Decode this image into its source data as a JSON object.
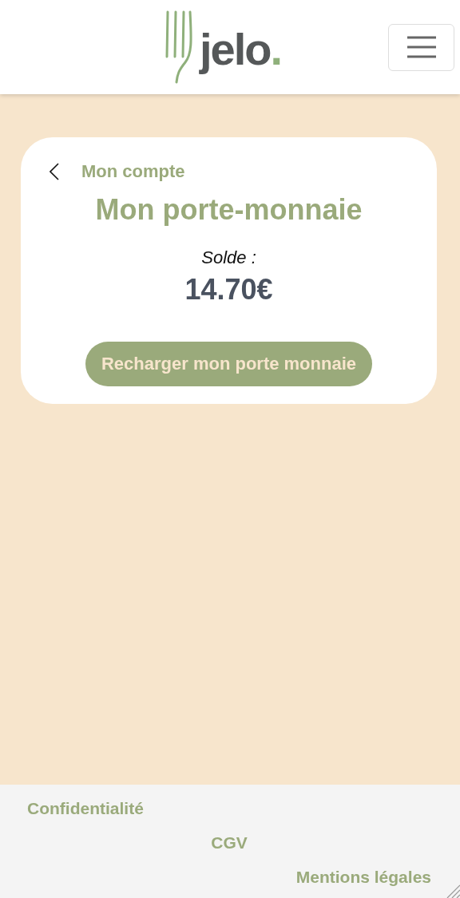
{
  "header": {
    "logo": {
      "name": "jelo",
      "dot": "."
    }
  },
  "card": {
    "back_link": "Mon compte",
    "title": "Mon porte-monnaie",
    "balance_label": "Solde :",
    "balance": "14.70€",
    "button": "Recharger mon porte monnaie"
  },
  "footer": {
    "links": [
      {
        "label": "Confidentialité"
      },
      {
        "label": "CGV"
      },
      {
        "label": "Mentions légales"
      }
    ]
  }
}
